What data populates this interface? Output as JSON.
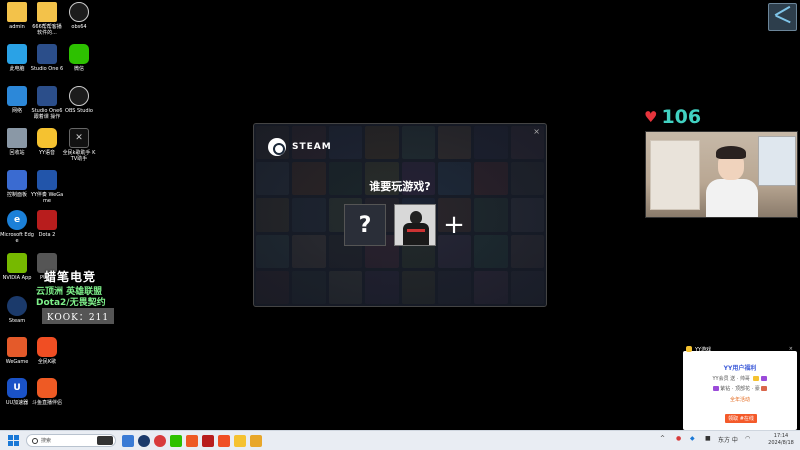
{
  "desktop_icons": {
    "admin": "admin",
    "folder2": "666帮帮客播 软件的...",
    "obs": "obs64",
    "thispc": "此电脑",
    "studio_one": "Studio One 6",
    "wechat": "微信",
    "network": "网络",
    "studio_one2": "Studio One6 跟着课 操作",
    "obs_studio": "OBS Studio",
    "recycle": "回收站",
    "yy": "YY语音",
    "toolbox": "全民k歌助手 KTV助手",
    "control": "控制面板",
    "yjp": "YY伴奏 WeGame",
    "edge": "Microsoft Edge",
    "dota2": "Dota 2",
    "nvidia": "NVIDIA App",
    "pubg": "PUBG",
    "steam": "Steam",
    "wegame": "WeGame",
    "wesing": "全民K歌",
    "uu": "UU加速器",
    "fire": "斗鱼直播伴侣"
  },
  "overlay": {
    "title": "蜡笔电竞",
    "line1": "云顶洲 英雄联盟",
    "line2": "Dota2/无畏契约",
    "kook": "KOOK：211"
  },
  "steam_dialog": {
    "brand": "STEAM",
    "close": "×",
    "prompt": "谁要玩游戏?",
    "unknown_slot": "?",
    "add": "+"
  },
  "live": {
    "likes": "106"
  },
  "yy_popup": {
    "tag": "YY游戏",
    "close": "×",
    "header": "YY用户福利",
    "row1": "YY会员 送 · 帅哥",
    "row2": "紫钻 · 顶部花 · 豪",
    "row3": "全年活动",
    "button": "领取  #在线"
  },
  "taskbar": {
    "search_placeholder": "搜索",
    "time": "17:14",
    "date": "2024/8/18",
    "tray_temp": "东方 中",
    "tray_lang": "中"
  },
  "colors": {
    "heart": "#e6343c",
    "likes": "#41d1c1",
    "overlay_green": "#7ef08a",
    "accent_blue": "#1a78d6"
  }
}
